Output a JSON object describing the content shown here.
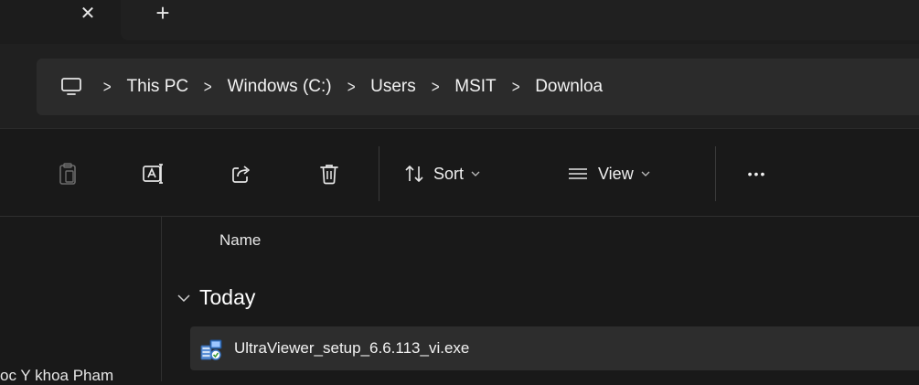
{
  "tabs": {
    "close_glyph": "✕",
    "new_glyph": "+"
  },
  "breadcrumb": {
    "items": [
      "This PC",
      "Windows (C:)",
      "Users",
      "MSIT",
      "Downloa"
    ],
    "separator": ">"
  },
  "commandbar": {
    "sort_label": "Sort",
    "view_label": "View",
    "more_label": "•••"
  },
  "columns": {
    "name": "Name"
  },
  "groups": [
    {
      "label": "Today",
      "files": [
        {
          "name": "UltraViewer_setup_6.6.113_vi.exe"
        }
      ]
    }
  ],
  "navpane": {
    "partial_item": "oc Y khoa Pham"
  },
  "colors": {
    "background": "#191919",
    "addressbar": "#2b2b2b",
    "row_selected": "#2d2d2d"
  }
}
